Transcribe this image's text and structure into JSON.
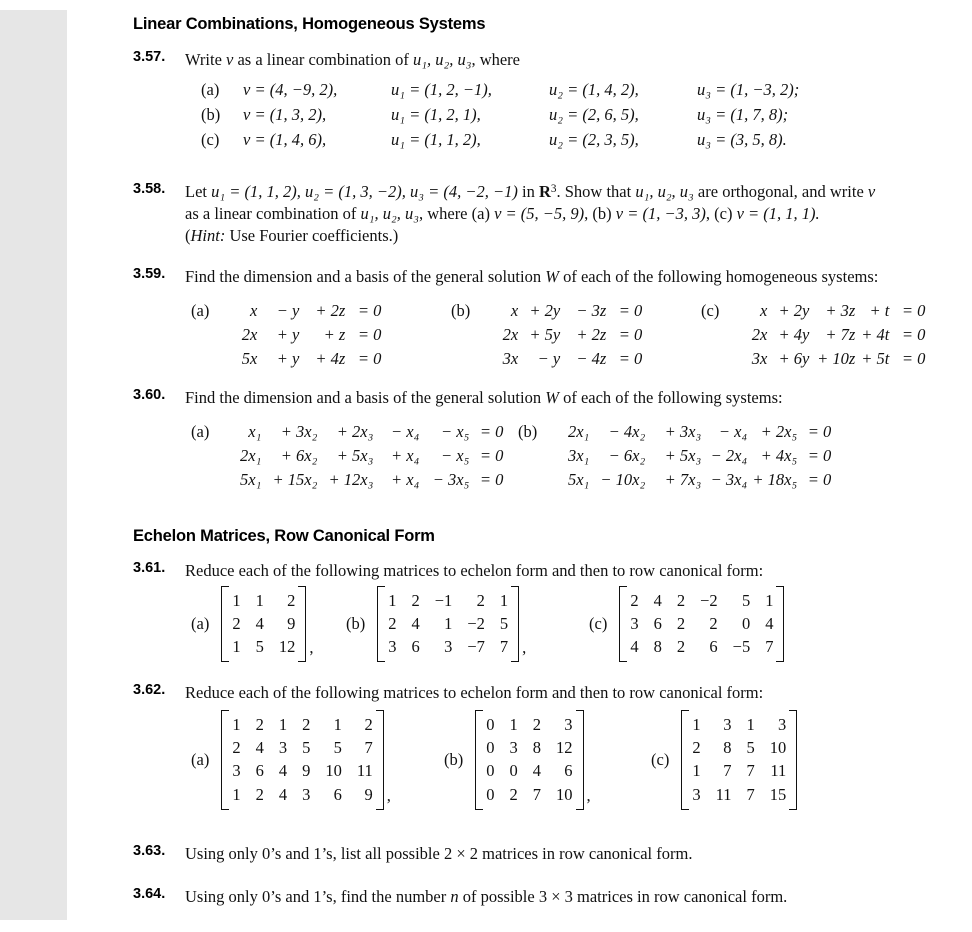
{
  "page": {
    "sections": [
      {
        "id": "linear-combinations",
        "heading": "Linear Combinations, Homogeneous Systems"
      },
      {
        "id": "echelon-matrices",
        "heading": "Echelon Matrices, Row Canonical Form"
      }
    ]
  },
  "p357": {
    "number": "3.57.",
    "text_1": "Write ",
    "text_v": "v",
    "text_2": " as a linear combination of ",
    "text_us": "u₁, u₂, u₃",
    "text_3": ", where",
    "items": [
      {
        "label": "(a)",
        "v": "v = (4, −9, 2),",
        "u1": "u₁ = (1, 2, −1),",
        "u2": "u₂ = (1, 4, 2),",
        "u3": "u₃ = (1, −3, 2);"
      },
      {
        "label": "(b)",
        "v": "v = (1, 3, 2),",
        "u1": "u₁ = (1, 2, 1),",
        "u2": "u₂ = (2, 6, 5),",
        "u3": "u₃ = (1, 7, 8);"
      },
      {
        "label": "(c)",
        "v": "v = (1, 4, 6),",
        "u1": "u₁ = (1, 1, 2),",
        "u2": "u₂ = (2, 3, 5),",
        "u3": "u₃ = (3, 5, 8)."
      }
    ]
  },
  "p358": {
    "number": "3.58.",
    "line1_a": "Let ",
    "line1_b": "u₁ = (1, 1, 2), u₂ = (1, 3, −2), u₃ = (4, −2, −1)",
    "line1_c": " in ",
    "line1_R": "R",
    "line1_exp": "3",
    "line1_d": ". Show that ",
    "line1_e": "u₁, u₂, u₃",
    "line1_f": " are orthogonal, and write ",
    "line1_v": "v",
    "line2_a": "as a linear combination of ",
    "line2_b": "u₁, u₂, u₃",
    "line2_c": ", where (a) ",
    "line2_d": "v = (5, −5, 9)",
    "line2_e": ", (b) ",
    "line2_f": "v = (1, −3, 3)",
    "line2_g": ", (c) ",
    "line2_h": "v = (1, 1, 1).",
    "line3_hint": "Hint:",
    "line3_rest": " Use Fourier coefficients.)"
  },
  "p359": {
    "number": "3.59.",
    "text_a": "Find the dimension and a basis of the general solution ",
    "text_W": "W",
    "text_b": " of each of the following homogeneous systems:",
    "groups": [
      {
        "label": "(a)",
        "rows": [
          [
            "x",
            "− y",
            "+ 2z",
            "",
            "= 0"
          ],
          [
            "2x",
            "+ y",
            "+  z",
            "",
            "= 0"
          ],
          [
            "5x",
            "+ y",
            "+ 4z",
            "",
            "= 0"
          ]
        ]
      },
      {
        "label": "(b)",
        "rows": [
          [
            "x",
            "+ 2y",
            "− 3z",
            "",
            "= 0"
          ],
          [
            "2x",
            "+ 5y",
            "+ 2z",
            "",
            "= 0"
          ],
          [
            "3x",
            "−  y",
            "− 4z",
            "",
            "= 0"
          ]
        ]
      },
      {
        "label": "(c)",
        "rows": [
          [
            "x",
            "+ 2y",
            "+  3z",
            "+  t",
            "= 0"
          ],
          [
            "2x",
            "+ 4y",
            "+  7z",
            "+ 4t",
            "= 0"
          ],
          [
            "3x",
            "+ 6y",
            "+ 10z",
            "+ 5t",
            "= 0"
          ]
        ]
      }
    ]
  },
  "p360": {
    "number": "3.60.",
    "text_a": "Find the dimension and a basis of the general solution ",
    "text_W": "W",
    "text_b": " of each of the following systems:",
    "groups": [
      {
        "label": "(a)",
        "rows": [
          [
            "x₁",
            "+  3x₂",
            "+  2x₃",
            "− x₄",
            "−  x₅",
            "= 0"
          ],
          [
            "2x₁",
            "+  6x₂",
            "+  5x₃",
            "+ x₄",
            "−  x₅",
            "= 0"
          ],
          [
            "5x₁",
            "+ 15x₂",
            "+ 12x₃",
            "+ x₄",
            "− 3x₅",
            "= 0"
          ]
        ]
      },
      {
        "label": "(b)",
        "rows": [
          [
            "2x₁",
            "−  4x₂",
            "+ 3x₃",
            "−  x₄",
            "+  2x₅",
            "= 0"
          ],
          [
            "3x₁",
            "−  6x₂",
            "+ 5x₃",
            "− 2x₄",
            "+  4x₅",
            "= 0"
          ],
          [
            "5x₁",
            "− 10x₂",
            "+ 7x₃",
            "− 3x₄",
            "+ 18x₅",
            "= 0"
          ]
        ]
      }
    ]
  },
  "p361": {
    "number": "3.61.",
    "text": "Reduce each of the following matrices to echelon form and then to row canonical form:",
    "matrices": [
      {
        "label": "(a)",
        "rows": [
          [
            "1",
            "1",
            "2"
          ],
          [
            "2",
            "4",
            "9"
          ],
          [
            "1",
            "5",
            "12"
          ]
        ],
        "trailer": ","
      },
      {
        "label": "(b)",
        "rows": [
          [
            "1",
            "2",
            "−1",
            "2",
            "1"
          ],
          [
            "2",
            "4",
            "1",
            "−2",
            "5"
          ],
          [
            "3",
            "6",
            "3",
            "−7",
            "7"
          ]
        ],
        "trailer": ","
      },
      {
        "label": "(c)",
        "rows": [
          [
            "2",
            "4",
            "2",
            "−2",
            "5",
            "1"
          ],
          [
            "3",
            "6",
            "2",
            "2",
            "0",
            "4"
          ],
          [
            "4",
            "8",
            "2",
            "6",
            "−5",
            "7"
          ]
        ],
        "trailer": ""
      }
    ]
  },
  "p362": {
    "number": "3.62.",
    "text": "Reduce each of the following matrices to echelon form and then to row canonical form:",
    "matrices": [
      {
        "label": "(a)",
        "rows": [
          [
            "1",
            "2",
            "1",
            "2",
            "1",
            "2"
          ],
          [
            "2",
            "4",
            "3",
            "5",
            "5",
            "7"
          ],
          [
            "3",
            "6",
            "4",
            "9",
            "10",
            "11"
          ],
          [
            "1",
            "2",
            "4",
            "3",
            "6",
            "9"
          ]
        ],
        "trailer": ","
      },
      {
        "label": "(b)",
        "rows": [
          [
            "0",
            "1",
            "2",
            "3"
          ],
          [
            "0",
            "3",
            "8",
            "12"
          ],
          [
            "0",
            "0",
            "4",
            "6"
          ],
          [
            "0",
            "2",
            "7",
            "10"
          ]
        ],
        "trailer": ","
      },
      {
        "label": "(c)",
        "rows": [
          [
            "1",
            "3",
            "1",
            "3"
          ],
          [
            "2",
            "8",
            "5",
            "10"
          ],
          [
            "1",
            "7",
            "7",
            "11"
          ],
          [
            "3",
            "11",
            "7",
            "15"
          ]
        ],
        "trailer": ""
      }
    ]
  },
  "p363": {
    "number": "3.63.",
    "text_a": "Using only 0’s and 1’s, list all possible 2 × 2 matrices in row canonical form."
  },
  "p364": {
    "number": "3.64.",
    "text_a": "Using only 0’s and 1’s, find the number ",
    "text_n": "n",
    "text_b": " of possible 3 × 3 matrices in row canonical form."
  }
}
